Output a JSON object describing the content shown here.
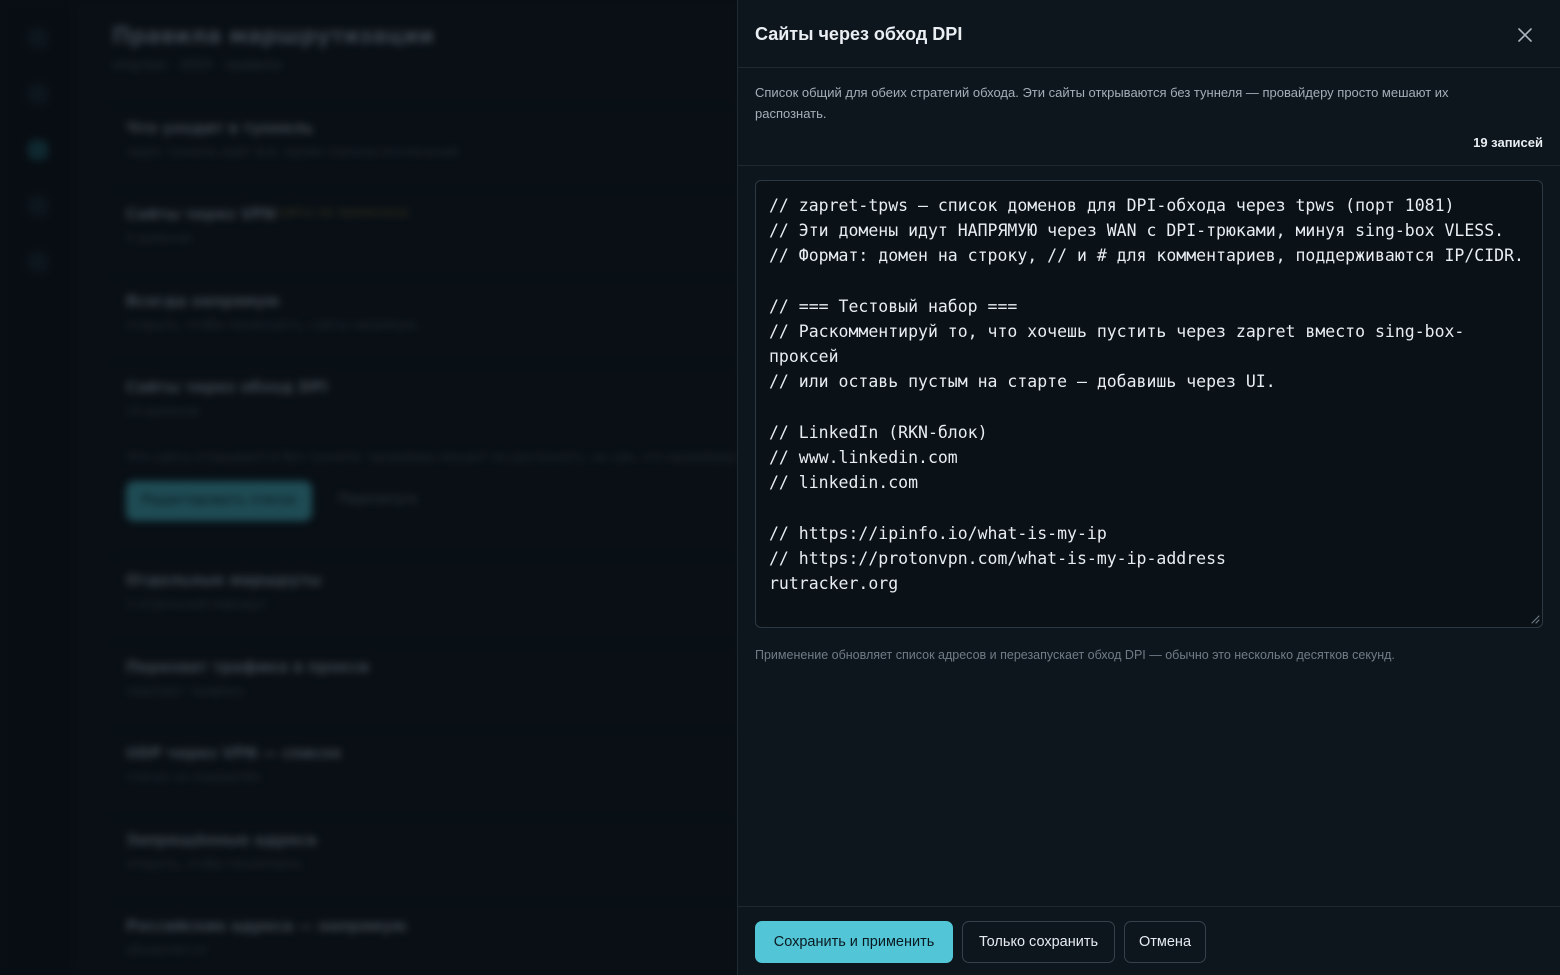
{
  "background": {
    "title": "Правила маршрутизации",
    "subtitle": "sing-box · 2025 · правила",
    "sections": [
      {
        "heading": "Что уходит в туннель",
        "desc": "через туннель идёт всё, кроме списков исключений"
      },
      {
        "heading": "Сайты через VPN",
        "desc": "0 доменов",
        "badge": "сайты не применены"
      },
      {
        "heading": "Всегда напрямую",
        "desc": "открыть, чтобы посмотреть, сайты напрямую"
      },
      {
        "heading": "Сайты через обход DPI",
        "desc": "19 доменов"
      },
      {
        "heading": "Отдельные маршруты",
        "desc": "1 отдельный маршрут"
      },
      {
        "heading": "Перехват трафика в прокси",
        "desc": "перехват трафика"
      },
      {
        "heading": "UDP через VPN — список",
        "desc": "список не определён"
      },
      {
        "heading": "Запрещённые адреса",
        "desc": "открыть, чтобы посмотреть"
      },
      {
        "heading": "Российские адреса — напрямую",
        "desc": "обновляется"
      }
    ],
    "note": "Эти сайты открываются без туннеля: провайдер мешает их распознать, но сам, что провайдер не может их",
    "primary_label": "Редактировать список",
    "secondary_label": "Перезапуск"
  },
  "drawer": {
    "title": "Сайты через обход DPI",
    "description": "Список общий для обеих стратегий обхода. Эти сайты открываются без туннеля — провайдеру просто мешают их распознать.",
    "count_label": "19 записей",
    "editor_content": "// zapret-tpws — список доменов для DPI-обхода через tpws (порт 1081)\n// Эти домены идут НАПРЯМУЮ через WAN с DPI-трюками, минуя sing-box VLESS.\n// Формат: домен на строку, // и # для комментариев, поддерживаются IP/CIDR.\n\n// === Тестовый набор ===\n// Раскомментируй то, что хочешь пустить через zapret вместо sing-box-проксей\n// или оставь пустым на старте — добавишь через UI.\n\n// LinkedIn (RKN-блок)\n// www.linkedin.com\n// linkedin.com\n\n// https://ipinfo.io/what-is-my-ip\n// https://protonvpn.com/what-is-my-ip-address\nrutracker.org",
    "hint": "Применение обновляет список адресов и перезапускает обход DPI — обычно это несколько десятков секунд.",
    "buttons": {
      "save_apply": "Сохранить и применить",
      "save_only": "Только сохранить",
      "cancel": "Отмена"
    },
    "icons": {
      "close": "close-icon",
      "resize": "resize-grip-icon"
    }
  },
  "colors": {
    "accent": "#52c6d6",
    "panel": "#0e161d",
    "text": "#e9eef2"
  }
}
